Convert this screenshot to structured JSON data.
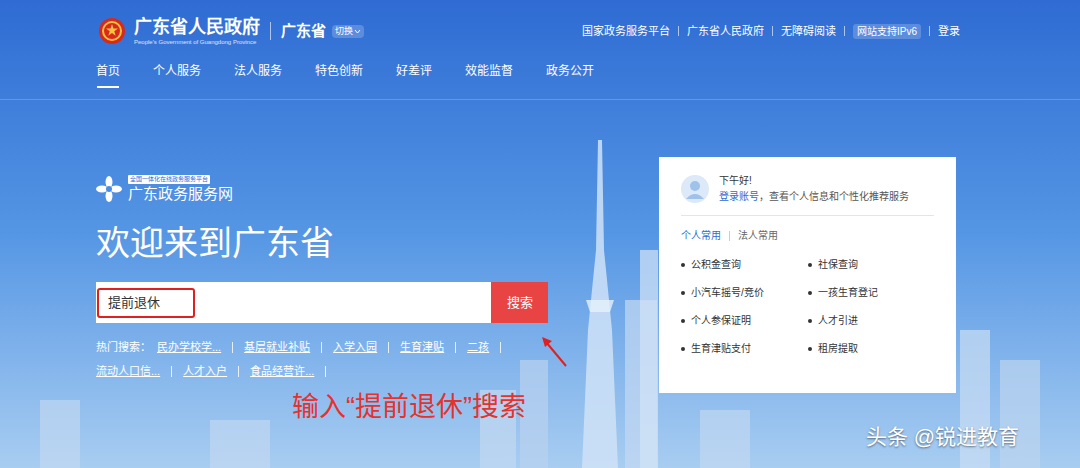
{
  "header": {
    "title": "广东省人民政府",
    "subtitle": "People's Government of Guangdong Province",
    "region": "广东省",
    "switch": "切换",
    "links": [
      "国家政务服务平台",
      "广东省人民政府",
      "无障碍阅读",
      "网站支持IPv6",
      "登录"
    ]
  },
  "nav": [
    {
      "label": "首页",
      "selected": true
    },
    {
      "label": "个人服务",
      "selected": false
    },
    {
      "label": "法人服务",
      "selected": false
    },
    {
      "label": "特色创新",
      "selected": false
    },
    {
      "label": "好差评",
      "selected": false
    },
    {
      "label": "效能监督",
      "selected": false
    },
    {
      "label": "政务公开",
      "selected": false
    }
  ],
  "brand": {
    "badge": "全国一体化在线政务服务平台",
    "name": "广东政务服务网"
  },
  "welcome": "欢迎来到广东省",
  "search": {
    "value": "提前退休",
    "button": "搜索"
  },
  "hot": {
    "label": "热门搜索：",
    "items": [
      "民办学校学...",
      "基层就业补贴",
      "入学入园",
      "生育津贴",
      "二孩",
      "流动人口信...",
      "人才入户",
      "食品经营许..."
    ]
  },
  "card": {
    "greeting": "下午好!",
    "login_link": "登录账号",
    "login_text": "，查看个人信息和个性化推荐服务",
    "tabs": [
      {
        "label": "个人常用",
        "selected": true
      },
      {
        "label": "法人常用",
        "selected": false
      }
    ],
    "items": [
      "公积金查询",
      "社保查询",
      "小汽车摇号/竞价",
      "一孩生育登记",
      "个人参保证明",
      "人才引进",
      "生育津贴支付",
      "租房提取"
    ]
  },
  "annotation": "输入“提前退休”搜索",
  "watermark": "头条 @锐进教育"
}
